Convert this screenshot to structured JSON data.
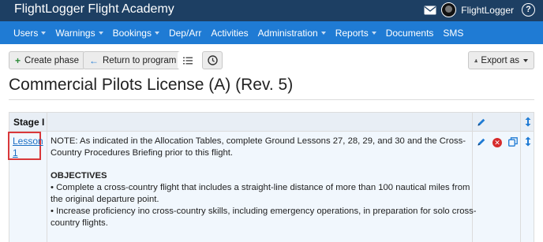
{
  "header": {
    "brand": "FlightLogger Flight Academy",
    "user_name": "FlightLogger",
    "help": "?"
  },
  "nav": {
    "items": [
      {
        "label": "Users",
        "dropdown": true
      },
      {
        "label": "Warnings",
        "dropdown": true
      },
      {
        "label": "Bookings",
        "dropdown": true
      },
      {
        "label": "Dep/Arr",
        "dropdown": false
      },
      {
        "label": "Activities",
        "dropdown": false
      },
      {
        "label": "Administration",
        "dropdown": true
      },
      {
        "label": "Reports",
        "dropdown": true
      },
      {
        "label": "Documents",
        "dropdown": false
      },
      {
        "label": "SMS",
        "dropdown": false
      }
    ]
  },
  "toolbar": {
    "create_phase": "Create phase",
    "return_to_program": "Return to program",
    "export_as": "Export as"
  },
  "page": {
    "title": "Commercial Pilots License (A) (Rev. 5)"
  },
  "table": {
    "stage_label": "Stage I",
    "lesson_link": "Lesson 1",
    "note": "NOTE: As indicated in the Allocation Tables, complete Ground Lessons 27, 28, 29, and 30 and the Cross-Country Procedures Briefing prior to this flight.",
    "objectives_heading": "OBJECTIVES",
    "objective_1": "• Complete a cross-country flight that includes a straight-line distance of more than 100 nautical miles from the original departure point.",
    "objective_2": "• Increase proficiency ino cross-country skills, including emergency operations, in preparation for solo cross-country flights."
  },
  "colors": {
    "topbar": "#1d3f63",
    "navbar": "#1f7bd4",
    "link": "#1a6fc4",
    "highlight": "#d9383a",
    "delete": "#d62b2b"
  }
}
